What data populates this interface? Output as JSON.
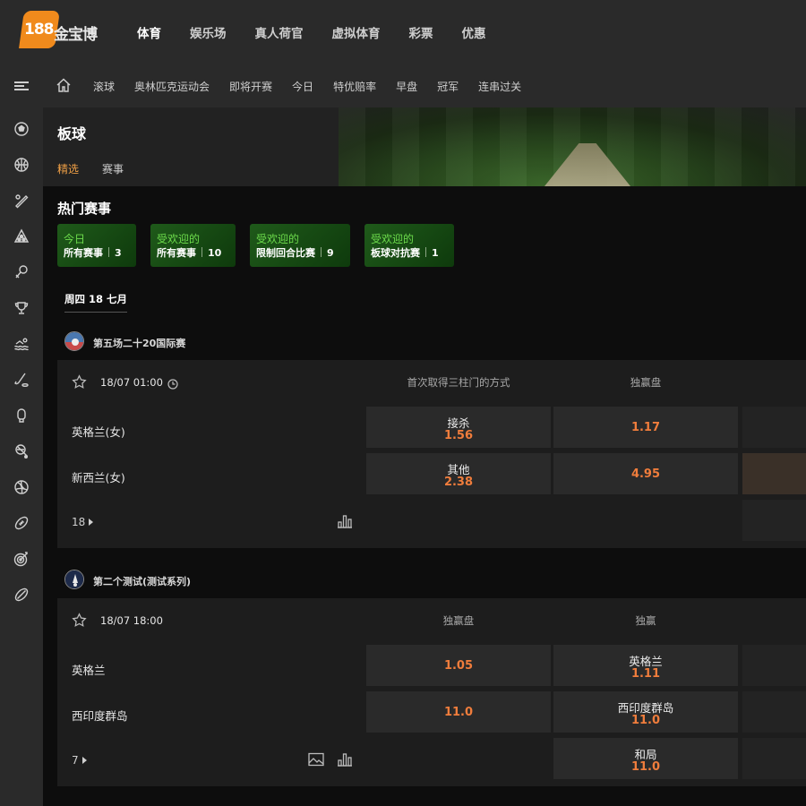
{
  "brand": {
    "logo_num": "188",
    "logo_text": "金宝博"
  },
  "top_nav": [
    "体育",
    "娱乐场",
    "真人荷官",
    "虚拟体育",
    "彩票",
    "优惠"
  ],
  "sub_nav": [
    "滚球",
    "奥林匹克运动会",
    "即将开赛",
    "今日",
    "特优赔率",
    "早盘",
    "冠军",
    "连串过关"
  ],
  "sidebar_icons": [
    "soccer-icon",
    "basketball-icon",
    "baseball-icon",
    "snooker-icon",
    "badminton-icon",
    "trophy-icon",
    "swimming-icon",
    "hockey-icon",
    "boxing-icon",
    "tennis-icon",
    "volleyball-icon",
    "football-icon",
    "darts-icon",
    "rugby-icon"
  ],
  "page": {
    "title": "板球",
    "tab_featured": "精选",
    "tab_events": "赛事"
  },
  "hot": {
    "title": "热门赛事",
    "chips": [
      {
        "top": "今日",
        "bottom": "所有赛事",
        "count": "3"
      },
      {
        "top": "受欢迎的",
        "bottom": "所有赛事",
        "count": "10"
      },
      {
        "top": "受欢迎的",
        "bottom": "限制回合比赛",
        "count": "9"
      },
      {
        "top": "受欢迎的",
        "bottom": "板球对抗赛",
        "count": "1"
      }
    ]
  },
  "date_label": "周四 18 七月",
  "competitions": [
    {
      "name": "第五场二十20国际赛",
      "time": "18/07 01:00",
      "col1": "首次取得三柱门的方式",
      "col2": "独赢盘",
      "teams": [
        "英格兰(女)",
        "新西兰(女)"
      ],
      "col1_odds": [
        {
          "label": "接杀",
          "value": "1.56"
        },
        {
          "label": "其他",
          "value": "2.38"
        }
      ],
      "col2_odds": [
        "1.17",
        "4.95"
      ],
      "more": "18"
    },
    {
      "name": "第二个测试(测试系列)",
      "time": "18/07 18:00",
      "col1": "独赢盘",
      "col2": "独赢",
      "teams": [
        "英格兰",
        "西印度群岛"
      ],
      "col1_odds": [
        "1.05",
        "11.0"
      ],
      "col2_odds": [
        {
          "label": "英格兰",
          "value": "1.11"
        },
        {
          "label": "西印度群岛",
          "value": "11.0"
        },
        {
          "label": "和局",
          "value": "11.0"
        }
      ],
      "more": "7"
    }
  ],
  "colors": {
    "accent": "#f07d3c",
    "tab_active": "#f0a046",
    "chip_green": "#6ddc4c",
    "logo_orange": "#f08a1c"
  }
}
